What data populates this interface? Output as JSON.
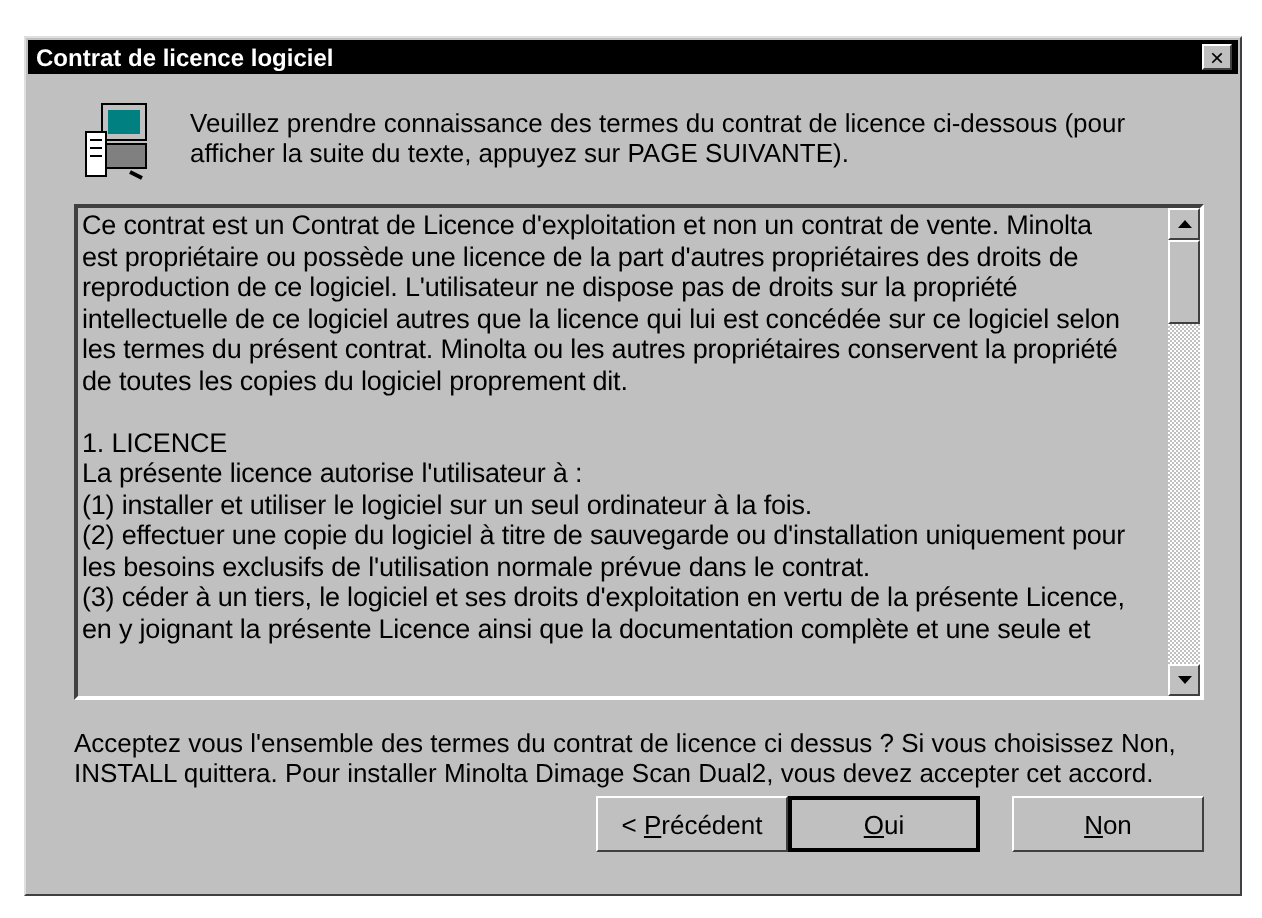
{
  "window": {
    "title": "Contrat de licence logiciel",
    "close": "×"
  },
  "intro": "Veuillez prendre connaissance des termes du contrat de licence ci-dessous (pour afficher la suite du texte, appuyez sur PAGE SUIVANTE).",
  "license_paragraphs": [
    {
      "lines": [
        "Ce contrat est un Contrat de Licence d'exploitation et non un contrat de vente. Minolta",
        "est propriétaire ou possède une licence de la part d'autres propriétaires des droits de",
        "reproduction de ce logiciel. L'utilisateur ne dispose pas de droits sur la propriété",
        "intellectuelle de ce logiciel autres que la licence qui lui est concédée sur ce logiciel selon",
        "les termes du présent contrat. Minolta ou les autres propriétaires conservent la propriété",
        "de toutes les copies du logiciel proprement dit."
      ]
    },
    {
      "lines": [
        "1. LICENCE",
        "La présente licence autorise l'utilisateur à :",
        "(1) installer et utiliser le logiciel sur un seul ordinateur à la fois.",
        "(2) effectuer une copie du logiciel à titre de sauvegarde ou d'installation uniquement pour",
        "les besoins exclusifs de l'utilisation normale prévue dans le contrat.",
        "(3) céder à un tiers, le logiciel et ses droits d'exploitation en vertu de la présente Licence,",
        "en y joignant la présente Licence ainsi que la documentation complète et une seule et"
      ]
    }
  ],
  "question": "Acceptez vous l'ensemble des termes du contrat de licence ci dessus ? Si vous choisissez Non, INSTALL quittera. Pour installer Minolta Dimage Scan Dual2, vous devez accepter cet accord.",
  "buttons": [
    {
      "before": "< ",
      "key": "P",
      "after": "récédent",
      "default": false
    },
    {
      "key": "O",
      "after": "ui",
      "default": true
    },
    {
      "key": "N",
      "after": "on",
      "default": false
    }
  ]
}
